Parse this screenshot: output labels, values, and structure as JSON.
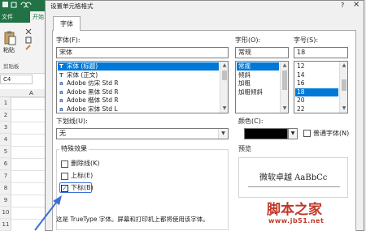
{
  "excel": {
    "file_tab": "文件",
    "home_tab": "开始",
    "paste_label": "粘贴",
    "clipboard_group": "剪贴板",
    "namebox_value": "C4",
    "column_header": "A",
    "row_numbers": [
      "1",
      "2",
      "3",
      "4",
      "5",
      "6",
      "7",
      "8",
      "9",
      "10",
      "11"
    ],
    "accent": "#217346"
  },
  "dialog": {
    "title": "设置单元格格式",
    "help": "?",
    "close": "×",
    "tab_label": "字体",
    "font_label": "字体(F):",
    "font_value": "宋体",
    "font_list": [
      {
        "icon": "T",
        "name": "宋体 (标题)",
        "selected": true
      },
      {
        "icon": "T",
        "name": "宋体 (正文)",
        "selected": false
      },
      {
        "icon": "a",
        "name": "Adobe 仿宋 Std R",
        "selected": false
      },
      {
        "icon": "a",
        "name": "Adobe 黑体 Std R",
        "selected": false
      },
      {
        "icon": "a",
        "name": "Adobe 楷体 Std R",
        "selected": false
      },
      {
        "icon": "a",
        "name": "Adobe 宋体 Std L",
        "selected": false
      }
    ],
    "style_label": "字形(O):",
    "style_value": "常规",
    "style_list": [
      {
        "name": "常规",
        "selected": true
      },
      {
        "name": "倾斜",
        "selected": false
      },
      {
        "name": "加粗",
        "selected": false
      },
      {
        "name": "加粗倾斜",
        "selected": false
      }
    ],
    "size_label": "字号(S):",
    "size_value": "18",
    "size_list": [
      {
        "name": "12",
        "selected": false
      },
      {
        "name": "14",
        "selected": false
      },
      {
        "name": "16",
        "selected": false
      },
      {
        "name": "18",
        "selected": true
      },
      {
        "name": "20",
        "selected": false
      },
      {
        "name": "22",
        "selected": false
      }
    ],
    "underline_label": "下划线(U):",
    "underline_value": "无",
    "color_label": "颜色(C):",
    "color_value": "#000000",
    "normal_font_label": "普通字体(N)",
    "effects_title": "特殊效果",
    "strikethrough_label": "删除线(K)",
    "superscript_label": "上标(E)",
    "subscript_label": "下标(B)",
    "subscript_checked": true,
    "preview_title": "预览",
    "preview_text": "微软卓越  AaBbCc",
    "truetype_note": "这是 TrueType 字体。屏幕和打印机上都将使用该字体。"
  },
  "watermark": {
    "brand": "脚本之家",
    "url": "www.jb51.net",
    "color": "#c0392b"
  },
  "annotation_color": "#3c6fd6"
}
